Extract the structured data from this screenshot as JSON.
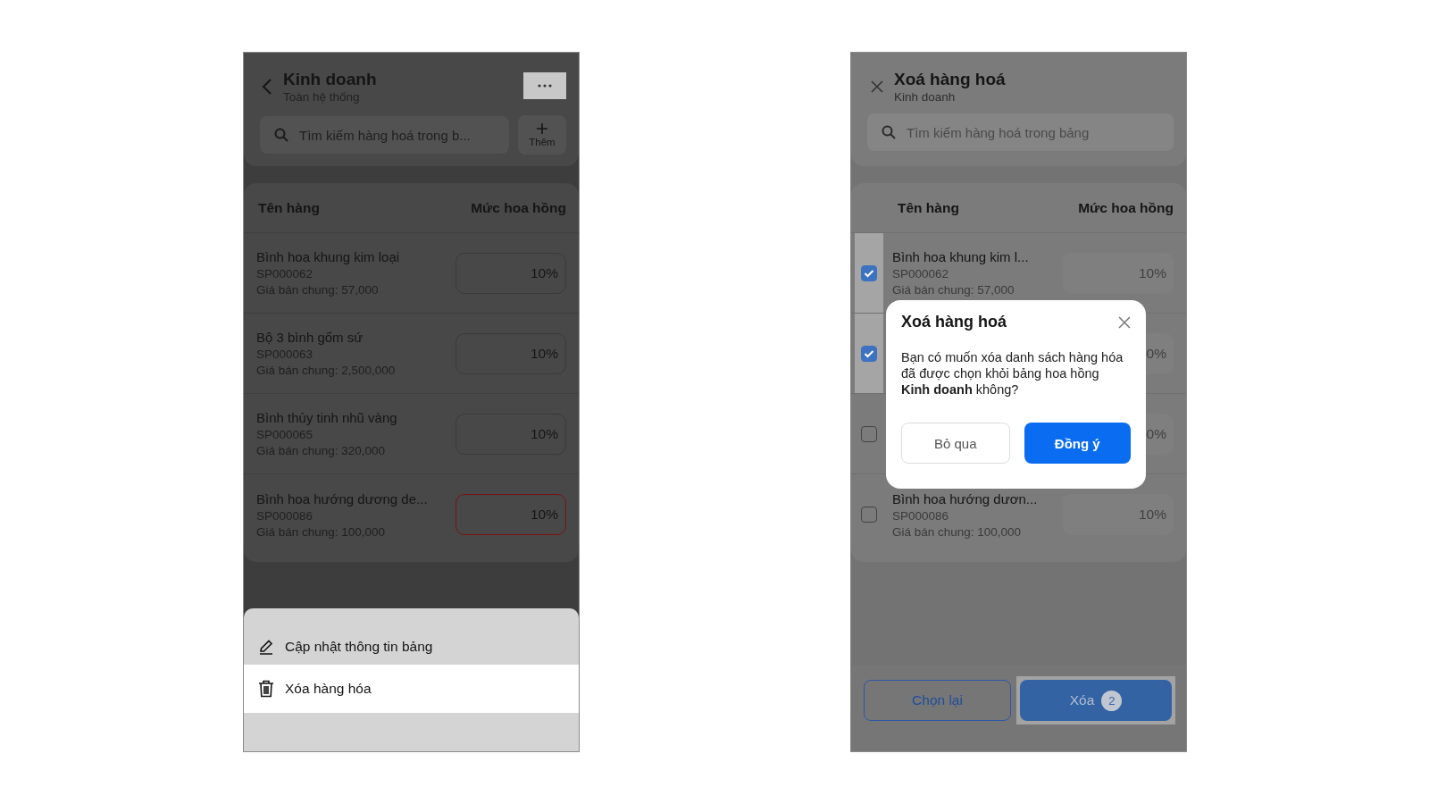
{
  "commission_screen": {
    "title": "Kinh doanh",
    "subtitle": "Toàn hệ thống",
    "search": {
      "placeholder": "Tìm kiếm hàng hoá trong b..."
    },
    "add_button": "Thêm",
    "columns": [
      "Tên hàng",
      "Mức hoa hồng"
    ],
    "rows": [
      {
        "name": "Bình hoa khung kim loại",
        "code": "SP000062",
        "price": "Giá bán chung: 57,000",
        "commission": "10%",
        "invalid": false
      },
      {
        "name": "Bộ 3 bình gốm sứ",
        "code": "SP000063",
        "price": "Giá bán chung: 2,500,000",
        "commission": "10%",
        "invalid": false
      },
      {
        "name": "Bình thủy tinh nhũ vàng",
        "code": "SP000065",
        "price": "Giá bán chung: 320,000",
        "commission": "10%",
        "invalid": false
      },
      {
        "name": "Bình hoa hướng dương de...",
        "code": "SP000086",
        "price": "Giá bán chung: 100,000",
        "commission": "10%",
        "invalid": true
      }
    ],
    "menu": [
      {
        "kind": "edit",
        "label": "Cập nhật thông tin bảng",
        "selected": false
      },
      {
        "kind": "delete",
        "label": "Xóa hàng hóa",
        "selected": true
      }
    ]
  },
  "delete_screen": {
    "title": "Xoá hàng hoá",
    "subtitle": "Kinh doanh",
    "search": {
      "placeholder": "Tìm kiếm hàng hoá trong bảng"
    },
    "columns": [
      "Tên hàng",
      "Mức hoa hồng"
    ],
    "rows": [
      {
        "checked": true,
        "name": "Bình hoa khung kim l...",
        "code": "SP000062",
        "price": "Giá bán chung: 57,000",
        "commission": "10%"
      },
      {
        "checked": true,
        "commission": "0%"
      },
      {
        "checked": false,
        "commission": "0%"
      },
      {
        "checked": false,
        "name": "Bình hoa hướng dươn...",
        "code": "SP000086",
        "price": "Giá bán chung: 100,000",
        "commission": "10%"
      }
    ],
    "footer": {
      "reset": "Chọn lại",
      "delete": "Xóa",
      "count": "2"
    },
    "dialog": {
      "title": "Xoá hàng hoá",
      "message": "Bạn có muốn xóa danh sách hàng hóa đã được chọn khỏi bảng hoa hồng **Kinh doanh** không?",
      "cancel": "Bỏ qua",
      "confirm": "Đồng ý"
    }
  }
}
